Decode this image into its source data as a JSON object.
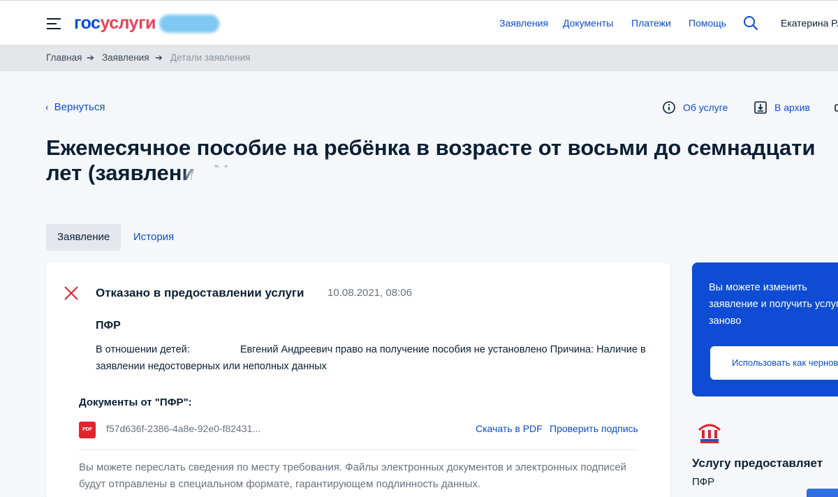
{
  "header": {
    "logo_gos": "гос",
    "logo_uslugi": "услуги",
    "nav": [
      "Заявления",
      "Документы",
      "Платежи",
      "Помощь"
    ],
    "user": "Екатерина Р."
  },
  "breadcrumb": {
    "items": [
      "Главная",
      "Заявления",
      "Детали заявления"
    ],
    "separator": "➔"
  },
  "back": {
    "label": "Вернуться"
  },
  "actions": {
    "about": "Об услуге",
    "archive": "В архив"
  },
  "page_title": "Ежемесячное пособие на ребёнка в возрасте от восьми до семнадцати лет (заявление №",
  "tabs": [
    "Заявление",
    "История"
  ],
  "card": {
    "status": "Отказано в предоставлении услуги",
    "date": "10.08.2021, 08:06",
    "org": "ПФР",
    "detail_prefix": "В отношении детей:",
    "detail_text": "Евгений Андреевич право на получение пособия не установлено Причина: Наличие в заявлении недостоверных или неполных данных",
    "docs_title": "Документы от \"ПФР\":",
    "pdf_badge": "PDF",
    "file_name": "f57d636f-2386-4a8e-92e0-f82431...",
    "download_link": "Скачать в PDF",
    "verify_link": "Проверить подпись",
    "note": "Вы можете переслать сведения по месту требования. Файлы электронных документов и электронных подписей будут отправлены в специальном формате, гарантирующем подлинность данных."
  },
  "side": {
    "text": "Вы можете изменить заявление и получить услугу заново",
    "button": "Использовать как черновик",
    "provider_label": "Услугу предоставляет",
    "provider_name": "ПФР"
  },
  "colors": {
    "accent": "#0d4cd3",
    "logo_red": "#ee3f58",
    "error": "#e2232e"
  }
}
